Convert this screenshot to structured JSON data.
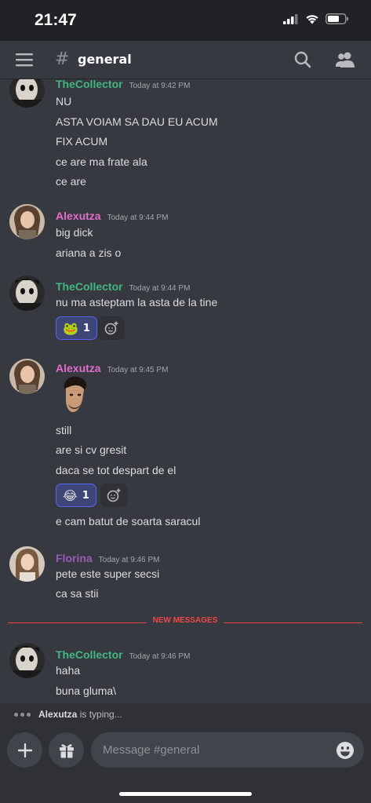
{
  "status_bar": {
    "time": "21:47"
  },
  "header": {
    "hash": "#",
    "channel": "general"
  },
  "messages": [
    {
      "author": "TheCollector",
      "time": "Today at 9:42 PM",
      "lines": [
        "NU",
        "ASTA VOIAM SA DAU EU ACUM",
        "FIX ACUM",
        "ce are ma frate ala",
        "ce are"
      ]
    },
    {
      "author": "Alexutza",
      "time": "Today at 9:44 PM",
      "lines": [
        "big dick",
        "ariana a zis o"
      ]
    },
    {
      "author": "TheCollector",
      "time": "Today at 9:44 PM",
      "lines": [
        "nu ma asteptam la asta de la tine"
      ],
      "reaction": {
        "emoji": "🐸",
        "count": "1"
      }
    },
    {
      "author": "Alexutza",
      "time": "Today at 9:45 PM",
      "lines": [
        "still",
        "are si cv gresit",
        "daca se tot despart de el",
        "e cam batut de soarta saracul"
      ],
      "reaction": {
        "emoji": "😂",
        "count": "1"
      }
    },
    {
      "author": "Florina",
      "time": "Today at 9:46 PM",
      "lines": [
        "pete este super secsi",
        "ca sa stii"
      ]
    },
    {
      "author": "TheCollector",
      "time": "Today at 9:46 PM",
      "lines": [
        "haha",
        "buna gluma\\"
      ]
    }
  ],
  "divider": {
    "label": "NEW MESSAGES"
  },
  "typing": {
    "user": "Alexutza",
    "suffix": " is typing..."
  },
  "composer": {
    "placeholder": "Message #general"
  },
  "colors": {
    "thecollector": "#43b581",
    "alexutza": "#e46bd0",
    "florina": "#9b59b6",
    "new_messages": "#f04747",
    "reaction_border": "#5865f2"
  }
}
